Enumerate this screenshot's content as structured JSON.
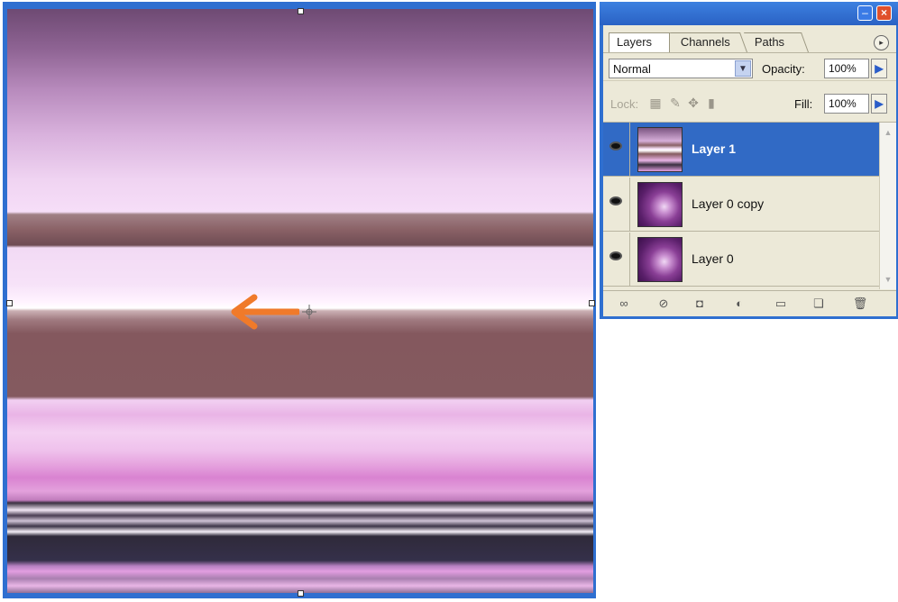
{
  "panel": {
    "tabs": [
      {
        "label": "Layers"
      },
      {
        "label": "Channels"
      },
      {
        "label": "Paths"
      }
    ],
    "blend_mode": "Normal",
    "opacity_label": "Opacity:",
    "opacity_value": "100%",
    "lock_label": "Lock:",
    "fill_label": "Fill:",
    "fill_value": "100%",
    "layers": [
      {
        "name": "Layer 1",
        "selected": true,
        "visible": true
      },
      {
        "name": "Layer 0 copy",
        "selected": false,
        "visible": true
      },
      {
        "name": "Layer 0",
        "selected": false,
        "visible": true
      }
    ],
    "bottom_icons": [
      "link-icon",
      "layer-style-icon",
      "mask-icon",
      "adjustment-icon",
      "group-icon",
      "new-layer-icon",
      "trash-icon"
    ]
  },
  "colors": {
    "selection_blue": "#316ac5",
    "window_blue": "#2f6fd0",
    "annotation_arrow": "#f07a2a",
    "panel_bg": "#ece9d8"
  }
}
